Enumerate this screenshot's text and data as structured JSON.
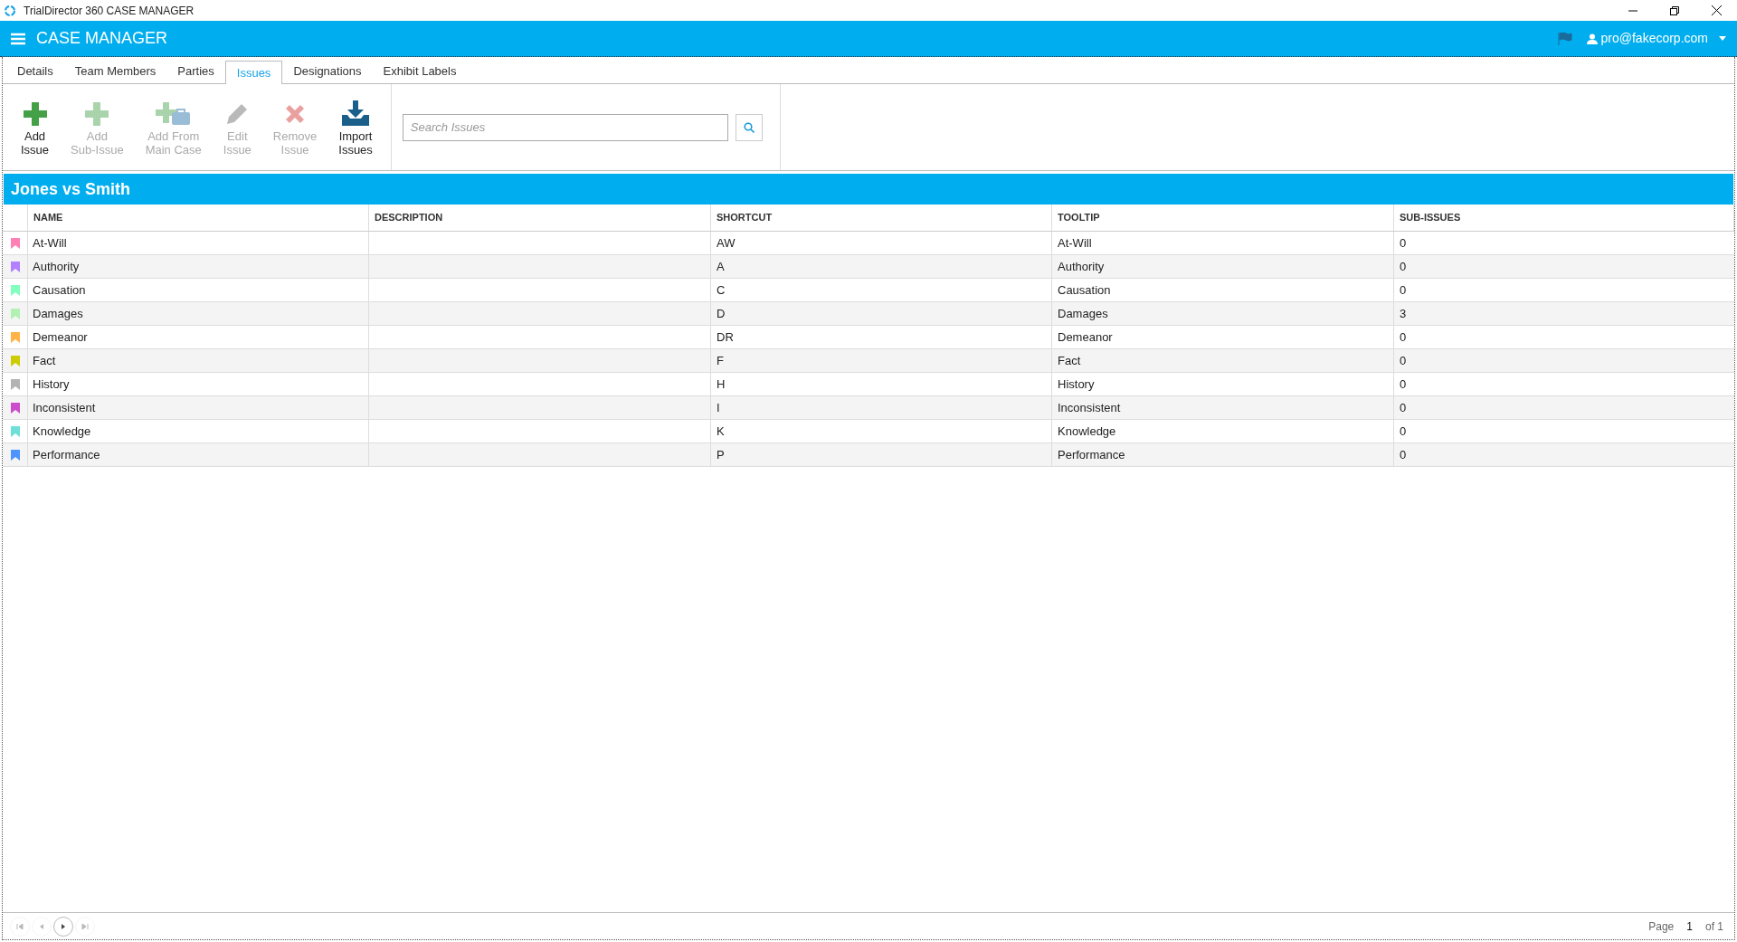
{
  "window": {
    "title": "TrialDirector 360 CASE MANAGER"
  },
  "header": {
    "title": "CASE MANAGER",
    "user": "pro@fakecorp.com"
  },
  "tabs": [
    {
      "label": "Details",
      "selected": false
    },
    {
      "label": "Team Members",
      "selected": false
    },
    {
      "label": "Parties",
      "selected": false
    },
    {
      "label": "Issues",
      "selected": true
    },
    {
      "label": "Designations",
      "selected": false
    },
    {
      "label": "Exhibit Labels",
      "selected": false
    }
  ],
  "toolbar": {
    "buttons": [
      {
        "kind": "add",
        "lines": [
          "Add",
          "Issue"
        ],
        "disabled": false
      },
      {
        "kind": "add-sub",
        "lines": [
          "Add",
          "Sub-Issue"
        ],
        "disabled": true
      },
      {
        "kind": "add-from",
        "lines": [
          "Add From",
          "Main Case"
        ],
        "disabled": true
      },
      {
        "kind": "edit",
        "lines": [
          "Edit",
          "Issue"
        ],
        "disabled": true
      },
      {
        "kind": "remove",
        "lines": [
          "Remove",
          "Issue"
        ],
        "disabled": true
      },
      {
        "kind": "import",
        "lines": [
          "Import",
          "Issues"
        ],
        "disabled": false
      }
    ],
    "search": {
      "placeholder": "Search Issues"
    }
  },
  "case": {
    "title": "Jones vs Smith"
  },
  "table": {
    "columns": [
      "NAME",
      "DESCRIPTION",
      "SHORTCUT",
      "TOOLTIP",
      "SUB-ISSUES"
    ],
    "rows": [
      {
        "color": "#ff80b4",
        "name": "At-Will",
        "shortcut": "AW",
        "tooltip": "At-Will",
        "sub_issues": "0"
      },
      {
        "color": "#b380ff",
        "name": "Authority",
        "shortcut": "A",
        "tooltip": "Authority",
        "sub_issues": "0"
      },
      {
        "color": "#80ffbf",
        "name": "Causation",
        "shortcut": "C",
        "tooltip": "Causation",
        "sub_issues": "0"
      },
      {
        "color": "#b3f0b3",
        "name": "Damages",
        "shortcut": "D",
        "tooltip": "Damages",
        "sub_issues": "3"
      },
      {
        "color": "#ffb347",
        "name": "Demeanor",
        "shortcut": "DR",
        "tooltip": "Demeanor",
        "sub_issues": "0"
      },
      {
        "color": "#cccc00",
        "name": "Fact",
        "shortcut": "F",
        "tooltip": "Fact",
        "sub_issues": "0"
      },
      {
        "color": "#b3b3b3",
        "name": "History",
        "shortcut": "H",
        "tooltip": "History",
        "sub_issues": "0"
      },
      {
        "color": "#cc4dcc",
        "name": "Inconsistent",
        "shortcut": "I",
        "tooltip": "Inconsistent",
        "sub_issues": "0"
      },
      {
        "color": "#6ee0d8",
        "name": "Knowledge",
        "shortcut": "K",
        "tooltip": "Knowledge",
        "sub_issues": "0"
      },
      {
        "color": "#4d94ff",
        "name": "Performance",
        "shortcut": "P",
        "tooltip": "Performance",
        "sub_issues": "0"
      }
    ]
  },
  "pager": {
    "buttons": [
      {
        "kind": "first",
        "disabled": true
      },
      {
        "kind": "prev",
        "disabled": true
      },
      {
        "kind": "next",
        "disabled": false
      },
      {
        "kind": "last",
        "disabled": true
      }
    ],
    "page_label": "Page",
    "page": "1",
    "of": "of 1"
  }
}
